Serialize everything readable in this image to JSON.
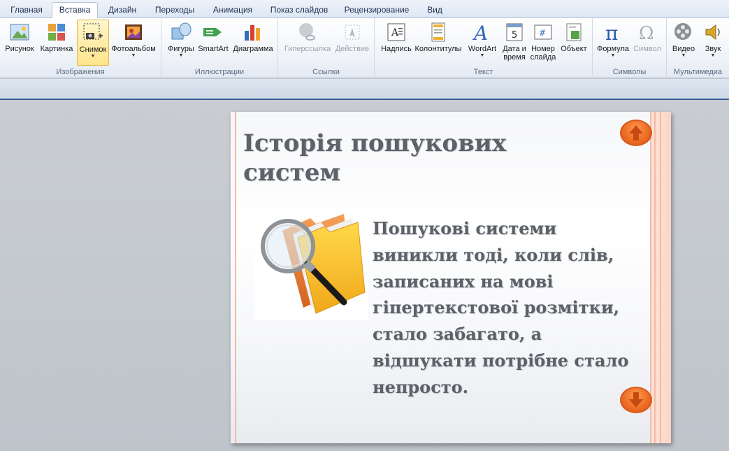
{
  "tabs": [
    {
      "label": "Главная"
    },
    {
      "label": "Вставка"
    },
    {
      "label": "Дизайн"
    },
    {
      "label": "Переходы"
    },
    {
      "label": "Анимация"
    },
    {
      "label": "Показ слайдов"
    },
    {
      "label": "Рецензирование"
    },
    {
      "label": "Вид"
    }
  ],
  "ribbon": {
    "groups": {
      "images": {
        "label": "Изображения",
        "buttons": [
          "Рисунок",
          "Картинка",
          "Снимок",
          "Фотоальбом"
        ]
      },
      "illustrations": {
        "label": "Иллюстрации",
        "buttons": [
          "Фигуры",
          "SmartArt",
          "Диаграмма"
        ]
      },
      "links": {
        "label": "Ссылки",
        "buttons": [
          "Гиперссылка",
          "Действие"
        ]
      },
      "text": {
        "label": "Текст",
        "buttons": [
          "Надпись",
          "Колонтитулы",
          "WordArt",
          "Дата и",
          "время",
          "Номер",
          "слайда",
          "Объект"
        ]
      },
      "symbols": {
        "label": "Символы",
        "buttons": [
          "Формула",
          "Символ"
        ]
      },
      "media": {
        "label": "Мультимедиа",
        "buttons": [
          "Видео",
          "Звук"
        ]
      }
    }
  },
  "slide": {
    "title_line1": "Історія пошукових",
    "title_line2": "систем",
    "body_lines": [
      "Пошукові системи",
      "виникли тоді, коли слів,",
      "записаних на мові",
      "гіпертекстової розмітки,",
      "стало забагато, а",
      "відшукати потрібне стало",
      "непросто."
    ]
  },
  "colors": {
    "accent_orange": "#e8631d",
    "slide_text": "#5d6168",
    "ribbon_selected": "#ffe48a"
  }
}
